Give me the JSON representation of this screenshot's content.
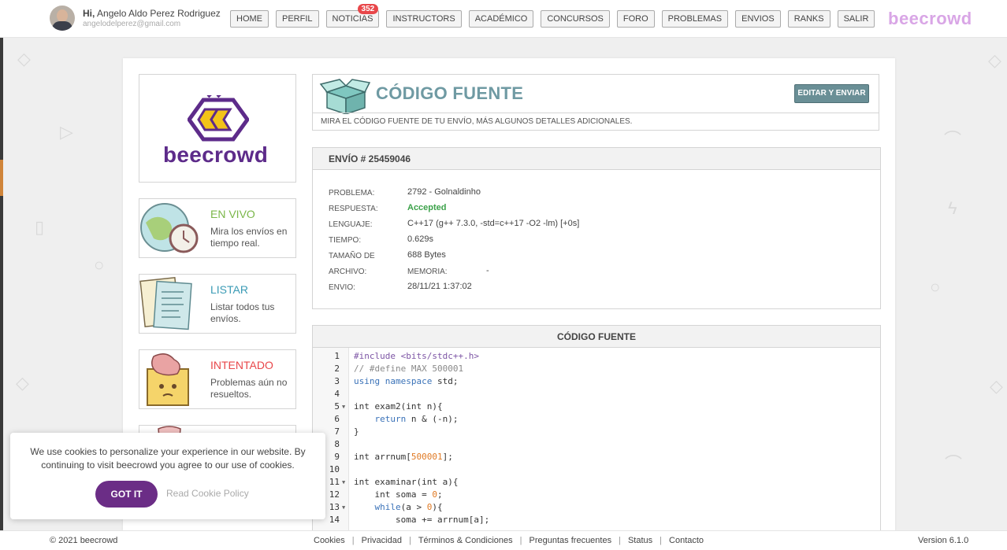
{
  "user": {
    "greeting": "Hi,",
    "name": "Angelo Aldo Perez Rodriguez",
    "email": "angelodelperez@gmail.com"
  },
  "nav": {
    "items": [
      "HOME",
      "PERFIL",
      "NOTICIAS",
      "INSTRUCTORS",
      "ACADÉMICO",
      "CONCURSOS",
      "FORO",
      "PROBLEMAS",
      "ENVIOS",
      "RANKS",
      "SALIR"
    ],
    "notifications_badge": "352"
  },
  "brand": {
    "name": "beecrowd",
    "accent": "#5d2b8a",
    "light_accent": "#d9a6e6"
  },
  "sidebar": {
    "cards": [
      {
        "title": "EN VIVO",
        "desc": "Mira los envíos en tiempo real.",
        "color": "#7ab648"
      },
      {
        "title": "LISTAR",
        "desc": "Listar todos tus envíos.",
        "color": "#3b9bb5"
      },
      {
        "title": "INTENTADO",
        "desc": "Problemas aún no resueltos.",
        "color": "#e8474a"
      }
    ]
  },
  "code_header": {
    "title": "CÓDIGO FUENTE",
    "subtitle": "MIRA EL CÓDIGO FUENTE DE TU ENVÍO, MÁS ALGUNOS DETALLES ADICIONALES.",
    "edit_button": "EDITAR Y ENVIAR"
  },
  "submission": {
    "heading": "ENVÍO # 25459046",
    "rows": [
      {
        "label": "PROBLEMA:",
        "value": "2792 - Golnaldinho"
      },
      {
        "label": "RESPUESTA:",
        "value": "Accepted"
      },
      {
        "label": "LENGUAJE:",
        "value": "C++17 (g++ 7.3.0, -std=c++17 -O2 -lm) [+0s]"
      },
      {
        "label": "TIEMPO:",
        "value": "0.629s"
      },
      {
        "label": "TAMAÑO DE",
        "value": "688 Bytes"
      },
      {
        "label": "ARCHIVO:",
        "memory_label": "MEMORIA:",
        "memory_value": "-"
      },
      {
        "label": "ENVIO:",
        "value": "28/11/21 1:37:02"
      }
    ],
    "accepted_color": "#3ca24a"
  },
  "source": {
    "heading": "CÓDIGO FUENTE",
    "lines": [
      {
        "n": "1",
        "text": "#include <bits/stdc++.h>"
      },
      {
        "n": "2",
        "text": "// #define MAX 500001"
      },
      {
        "n": "3",
        "text": "using namespace std;"
      },
      {
        "n": "4",
        "text": ""
      },
      {
        "n": "5",
        "text": "int exam2(int n){",
        "fold": true
      },
      {
        "n": "6",
        "text": "    return n & (-n);"
      },
      {
        "n": "7",
        "text": "}"
      },
      {
        "n": "8",
        "text": ""
      },
      {
        "n": "9",
        "text": "int arrnum[500001];"
      },
      {
        "n": "10",
        "text": ""
      },
      {
        "n": "11",
        "text": "int examinar(int a){",
        "fold": true
      },
      {
        "n": "12",
        "text": "    int soma = 0;"
      },
      {
        "n": "13",
        "text": "    while(a > 0){",
        "fold": true
      },
      {
        "n": "14",
        "text": "        soma += arrnum[a];"
      }
    ]
  },
  "cookie": {
    "text": "We use cookies to personalize your experience in our website. By continuing to visit beecrowd you agree to our use of cookies.",
    "accept": "GOT IT",
    "policy": "Read Cookie Policy"
  },
  "footer": {
    "copyright": "© 2021 beecrowd",
    "links": [
      "Cookies",
      "Privacidad",
      "Términos & Condiciones",
      "Preguntas frecuentes",
      "Status",
      "Contacto"
    ],
    "version": "Version 6.1.0"
  }
}
